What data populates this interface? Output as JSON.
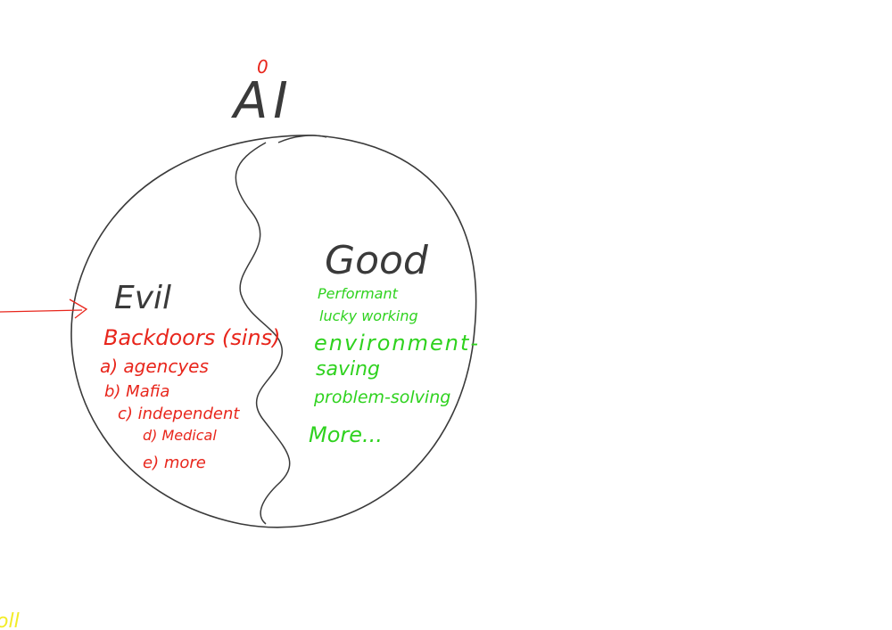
{
  "title": {
    "superscript": "0",
    "text": "AI"
  },
  "evil": {
    "heading": "Evil",
    "subheading": "Backdoors (sins)",
    "items": [
      "a) agencyes",
      "b) Mafia",
      "c) independent",
      "d) Medical",
      "e) more"
    ]
  },
  "good": {
    "heading": "Good",
    "items": [
      "Performant",
      "lucky working",
      "environment-",
      "saving",
      "problem-solving",
      "More..."
    ]
  },
  "bottom_note": "oll",
  "colors": {
    "ink": "#3a3a3a",
    "evil": "#e8261c",
    "good": "#2fd21f",
    "note": "#f2ec27",
    "background": "#ffffff"
  }
}
